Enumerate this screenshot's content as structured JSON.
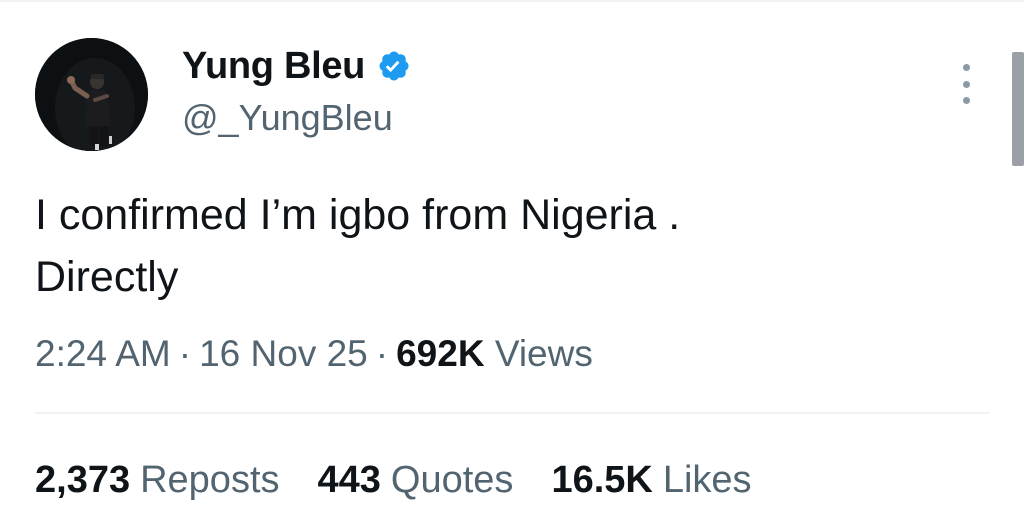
{
  "user": {
    "display_name": "Yung Bleu",
    "handle": "@_YungBleu",
    "verified": true,
    "avatar_icon": "profile-photo"
  },
  "tweet": {
    "text": "I confirmed I’m igbo from Nigeria .\nDirectly",
    "time": "2:24 AM",
    "date": "16 Nov 25",
    "views_count": "692K",
    "views_label": "Views"
  },
  "stats": {
    "reposts_count": "2,373",
    "reposts_label": "Reposts",
    "quotes_count": "443",
    "quotes_label": "Quotes",
    "likes_count": "16.5K",
    "likes_label": "Likes"
  },
  "icons": {
    "verified": "verified-badge-icon",
    "more": "more-options-icon"
  },
  "colors": {
    "verified_blue": "#1d9bf0",
    "secondary_text": "#536471",
    "primary_text": "#0f1419"
  }
}
